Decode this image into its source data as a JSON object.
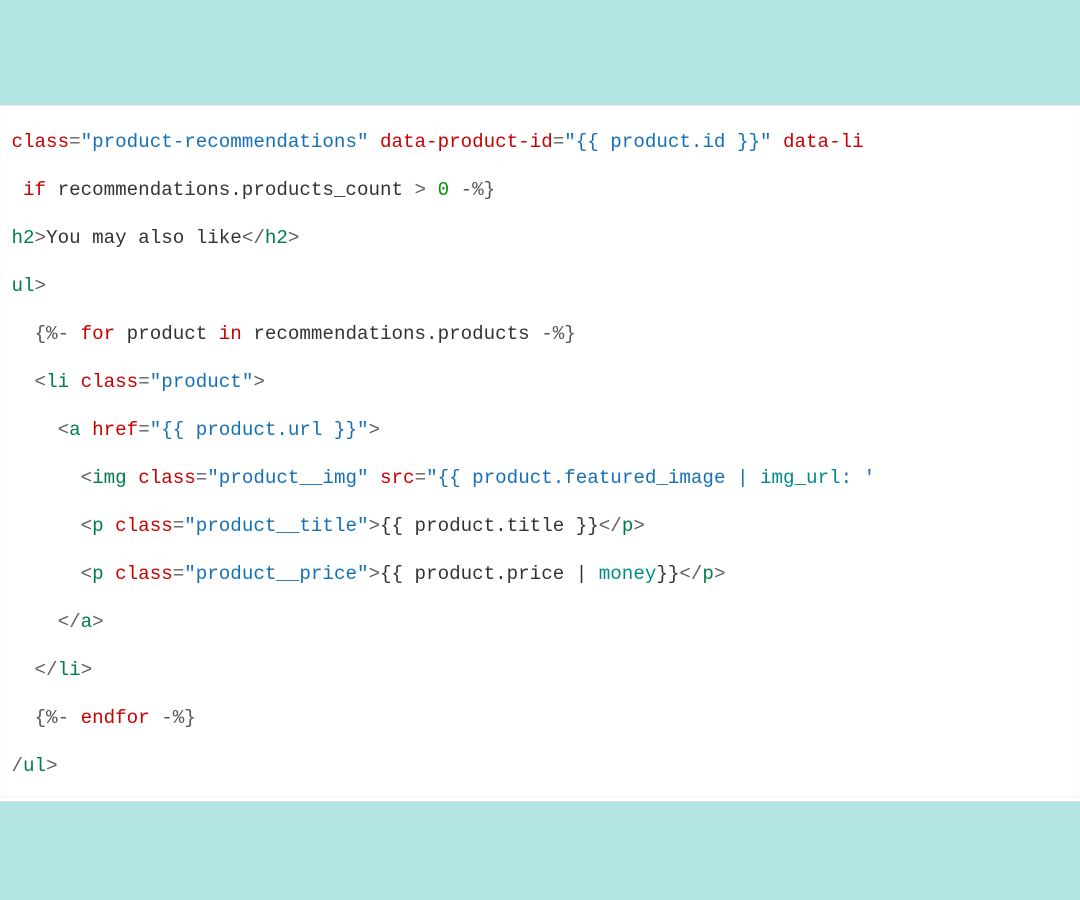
{
  "code": {
    "line1": {
      "a": " ",
      "attr1": "class",
      "eq": "=",
      "q": "\"",
      "str1": "product-recommendations",
      "sp": " ",
      "attr2": "data-product-id",
      "str2": "{{ product.id }}",
      "attr3": "data-li"
    },
    "line2": {
      "indent": "  ",
      "kw": "if",
      "rest": " recommendations.products_count ",
      "op": ">",
      "sp": " ",
      "num": "0",
      "close": " -%}"
    },
    "line3": {
      "open": " h2",
      "gt": ">",
      "text": "You may also like",
      "close": "</",
      "tag": "h2",
      "end": ">"
    },
    "line4": {
      "open": " ul",
      "gt": ">"
    },
    "line5": {
      "indent": "   ",
      "lq1": "{%- ",
      "kw1": "for",
      "mid1": " product ",
      "kw2": "in",
      "mid2": " recommendations.products ",
      "lq2": "-%}"
    },
    "line6": {
      "indent": "   ",
      "lt": "<",
      "tag": "li",
      "sp": " ",
      "attr": "class",
      "eq": "=",
      "q": "\"",
      "str": "product",
      "gt": ">"
    },
    "line7": {
      "indent": "     ",
      "lt": "<",
      "tag": "a",
      "sp": " ",
      "attr": "href",
      "eq": "=",
      "q": "\"",
      "str": "{{ product.url }}",
      "gt": ">"
    },
    "line8": {
      "indent": "       ",
      "lt": "<",
      "tag": "img",
      "sp": " ",
      "attr1": "class",
      "eq": "=",
      "q": "\"",
      "str1": "product__img",
      "attr2": "src",
      "str2a": "{{ product.featured_image | ",
      "filter": "img_url",
      "str2b": ": '"
    },
    "line9": {
      "indent": "       ",
      "lt": "<",
      "tag": "p",
      "sp": " ",
      "attr": "class",
      "eq": "=",
      "q": "\"",
      "str": "product__title",
      "gt": ">",
      "body": "{{ product.title }}",
      "close": "</",
      "tag2": "p",
      "end": ">"
    },
    "line10": {
      "indent": "       ",
      "lt": "<",
      "tag": "p",
      "sp": " ",
      "attr": "class",
      "eq": "=",
      "q": "\"",
      "str": "product__price",
      "gt": ">",
      "bodyA": "{{ product.price | ",
      "filter": "money",
      "bodyB": "}}",
      "close": "</",
      "tag2": "p",
      "end": ">"
    },
    "line11": {
      "indent": "     ",
      "close": "</",
      "tag": "a",
      "end": ">"
    },
    "line12": {
      "indent": "   ",
      "close": "</",
      "tag": "li",
      "end": ">"
    },
    "line13": {
      "indent": "   ",
      "lq1": "{%- ",
      "kw": "endfor",
      "lq2": " -%}"
    },
    "line14": {
      "close": " /",
      "tag": "ul",
      "end": ">"
    }
  }
}
